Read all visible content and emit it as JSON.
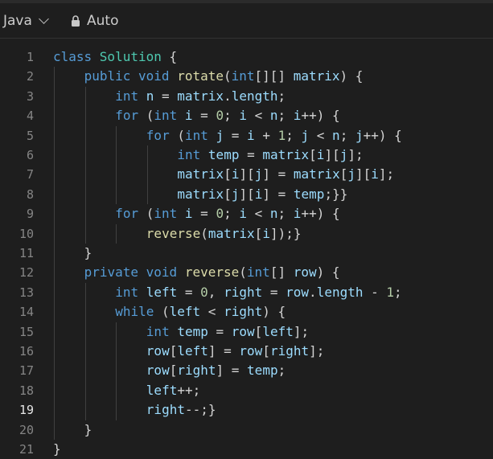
{
  "header": {
    "language": "Java",
    "mode": "Auto",
    "icons": [
      "chevron-down-icon",
      "lock-icon"
    ]
  },
  "editor": {
    "active_line": 19,
    "colors": {
      "background": "#1e1e1e",
      "keyword": "#569cd6",
      "type": "#4ec9b0",
      "function": "#dcdcaa",
      "variable": "#9cdcfe",
      "number": "#b5cea8",
      "text": "#d4d4d4"
    },
    "lines": [
      {
        "n": "1",
        "indent": 0,
        "tokens": [
          [
            "kw",
            "class "
          ],
          [
            "ty",
            "Solution"
          ],
          [
            "pl",
            " {"
          ]
        ]
      },
      {
        "n": "2",
        "indent": 1,
        "tokens": [
          [
            "kw",
            "public void "
          ],
          [
            "fn",
            "rotate"
          ],
          [
            "pl",
            "("
          ],
          [
            "kw",
            "int"
          ],
          [
            "pl",
            "[][] "
          ],
          [
            "vr",
            "matrix"
          ],
          [
            "pl",
            ") {"
          ]
        ]
      },
      {
        "n": "3",
        "indent": 2,
        "tokens": [
          [
            "kw",
            "int "
          ],
          [
            "vr",
            "n"
          ],
          [
            "pl",
            " = "
          ],
          [
            "vr",
            "matrix"
          ],
          [
            "pl",
            "."
          ],
          [
            "vr",
            "length"
          ],
          [
            "pl",
            ";"
          ]
        ]
      },
      {
        "n": "4",
        "indent": 2,
        "tokens": [
          [
            "kw",
            "for"
          ],
          [
            "pl",
            " ("
          ],
          [
            "kw",
            "int "
          ],
          [
            "vr",
            "i"
          ],
          [
            "pl",
            " = "
          ],
          [
            "nm",
            "0"
          ],
          [
            "pl",
            "; "
          ],
          [
            "vr",
            "i"
          ],
          [
            "pl",
            " < "
          ],
          [
            "vr",
            "n"
          ],
          [
            "pl",
            "; "
          ],
          [
            "vr",
            "i"
          ],
          [
            "pl",
            "++) {"
          ]
        ]
      },
      {
        "n": "5",
        "indent": 3,
        "tokens": [
          [
            "kw",
            "for"
          ],
          [
            "pl",
            " ("
          ],
          [
            "kw",
            "int "
          ],
          [
            "vr",
            "j"
          ],
          [
            "pl",
            " = "
          ],
          [
            "vr",
            "i"
          ],
          [
            "pl",
            " + "
          ],
          [
            "nm",
            "1"
          ],
          [
            "pl",
            "; "
          ],
          [
            "vr",
            "j"
          ],
          [
            "pl",
            " < "
          ],
          [
            "vr",
            "n"
          ],
          [
            "pl",
            "; "
          ],
          [
            "vr",
            "j"
          ],
          [
            "pl",
            "++) {"
          ]
        ]
      },
      {
        "n": "6",
        "indent": 4,
        "tokens": [
          [
            "kw",
            "int "
          ],
          [
            "vr",
            "temp"
          ],
          [
            "pl",
            " = "
          ],
          [
            "vr",
            "matrix"
          ],
          [
            "pl",
            "["
          ],
          [
            "vr",
            "i"
          ],
          [
            "pl",
            "]["
          ],
          [
            "vr",
            "j"
          ],
          [
            "pl",
            "];"
          ]
        ]
      },
      {
        "n": "7",
        "indent": 4,
        "tokens": [
          [
            "vr",
            "matrix"
          ],
          [
            "pl",
            "["
          ],
          [
            "vr",
            "i"
          ],
          [
            "pl",
            "]["
          ],
          [
            "vr",
            "j"
          ],
          [
            "pl",
            "] = "
          ],
          [
            "vr",
            "matrix"
          ],
          [
            "pl",
            "["
          ],
          [
            "vr",
            "j"
          ],
          [
            "pl",
            "]["
          ],
          [
            "vr",
            "i"
          ],
          [
            "pl",
            "];"
          ]
        ]
      },
      {
        "n": "8",
        "indent": 4,
        "tokens": [
          [
            "vr",
            "matrix"
          ],
          [
            "pl",
            "["
          ],
          [
            "vr",
            "j"
          ],
          [
            "pl",
            "]["
          ],
          [
            "vr",
            "i"
          ],
          [
            "pl",
            "] = "
          ],
          [
            "vr",
            "temp"
          ],
          [
            "pl",
            ";}}"
          ]
        ]
      },
      {
        "n": "9",
        "indent": 2,
        "tokens": [
          [
            "kw",
            "for"
          ],
          [
            "pl",
            " ("
          ],
          [
            "kw",
            "int "
          ],
          [
            "vr",
            "i"
          ],
          [
            "pl",
            " = "
          ],
          [
            "nm",
            "0"
          ],
          [
            "pl",
            "; "
          ],
          [
            "vr",
            "i"
          ],
          [
            "pl",
            " < "
          ],
          [
            "vr",
            "n"
          ],
          [
            "pl",
            "; "
          ],
          [
            "vr",
            "i"
          ],
          [
            "pl",
            "++) {"
          ]
        ]
      },
      {
        "n": "10",
        "indent": 3,
        "tokens": [
          [
            "fn",
            "reverse"
          ],
          [
            "pl",
            "("
          ],
          [
            "vr",
            "matrix"
          ],
          [
            "pl",
            "["
          ],
          [
            "vr",
            "i"
          ],
          [
            "pl",
            "]);}"
          ]
        ]
      },
      {
        "n": "11",
        "indent": 1,
        "tokens": [
          [
            "pl",
            "}"
          ]
        ]
      },
      {
        "n": "12",
        "indent": 1,
        "tokens": [
          [
            "kw",
            "private void "
          ],
          [
            "fn",
            "reverse"
          ],
          [
            "pl",
            "("
          ],
          [
            "kw",
            "int"
          ],
          [
            "pl",
            "[] "
          ],
          [
            "vr",
            "row"
          ],
          [
            "pl",
            ") {"
          ]
        ]
      },
      {
        "n": "13",
        "indent": 2,
        "tokens": [
          [
            "kw",
            "int "
          ],
          [
            "vr",
            "left"
          ],
          [
            "pl",
            " = "
          ],
          [
            "nm",
            "0"
          ],
          [
            "pl",
            ", "
          ],
          [
            "vr",
            "right"
          ],
          [
            "pl",
            " = "
          ],
          [
            "vr",
            "row"
          ],
          [
            "pl",
            "."
          ],
          [
            "vr",
            "length"
          ],
          [
            "pl",
            " - "
          ],
          [
            "nm",
            "1"
          ],
          [
            "pl",
            ";"
          ]
        ]
      },
      {
        "n": "14",
        "indent": 2,
        "tokens": [
          [
            "kw",
            "while"
          ],
          [
            "pl",
            " ("
          ],
          [
            "vr",
            "left"
          ],
          [
            "pl",
            " < "
          ],
          [
            "vr",
            "right"
          ],
          [
            "pl",
            ") {"
          ]
        ]
      },
      {
        "n": "15",
        "indent": 3,
        "tokens": [
          [
            "kw",
            "int "
          ],
          [
            "vr",
            "temp"
          ],
          [
            "pl",
            " = "
          ],
          [
            "vr",
            "row"
          ],
          [
            "pl",
            "["
          ],
          [
            "vr",
            "left"
          ],
          [
            "pl",
            "];"
          ]
        ]
      },
      {
        "n": "16",
        "indent": 3,
        "tokens": [
          [
            "vr",
            "row"
          ],
          [
            "pl",
            "["
          ],
          [
            "vr",
            "left"
          ],
          [
            "pl",
            "] = "
          ],
          [
            "vr",
            "row"
          ],
          [
            "pl",
            "["
          ],
          [
            "vr",
            "right"
          ],
          [
            "pl",
            "];"
          ]
        ]
      },
      {
        "n": "17",
        "indent": 3,
        "tokens": [
          [
            "vr",
            "row"
          ],
          [
            "pl",
            "["
          ],
          [
            "vr",
            "right"
          ],
          [
            "pl",
            "] = "
          ],
          [
            "vr",
            "temp"
          ],
          [
            "pl",
            ";"
          ]
        ]
      },
      {
        "n": "18",
        "indent": 3,
        "tokens": [
          [
            "vr",
            "left"
          ],
          [
            "pl",
            "++;"
          ]
        ]
      },
      {
        "n": "19",
        "indent": 3,
        "tokens": [
          [
            "vr",
            "right"
          ],
          [
            "pl",
            "--;}"
          ]
        ]
      },
      {
        "n": "20",
        "indent": 1,
        "tokens": [
          [
            "pl",
            "}"
          ]
        ]
      },
      {
        "n": "21",
        "indent": 0,
        "tokens": [
          [
            "pl",
            "}"
          ]
        ]
      }
    ]
  }
}
